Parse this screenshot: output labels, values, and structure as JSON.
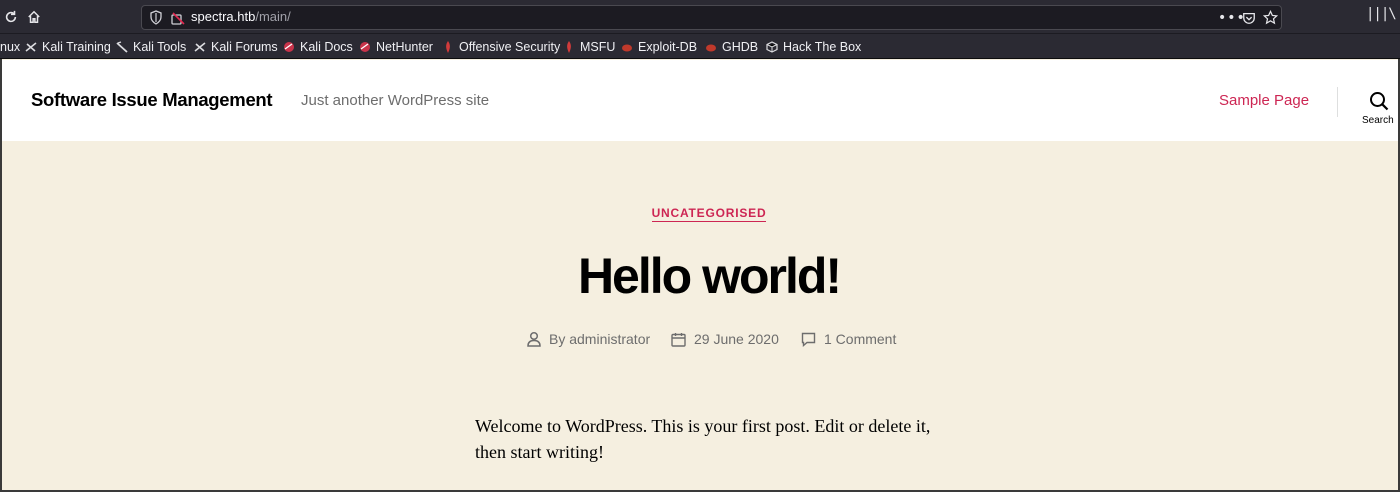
{
  "browser": {
    "url_host": "spectra.htb",
    "url_path": "/main/",
    "icons": [
      "reload-icon",
      "home-icon",
      "shield-icon",
      "page-actions-icon",
      "pocket-icon",
      "bookmark-star-icon",
      "library-icon"
    ],
    "bookmarks": [
      {
        "label": "nux",
        "icon": "none"
      },
      {
        "label": "Kali Training",
        "icon": "kali-icon"
      },
      {
        "label": "Kali Tools",
        "icon": "kali-icon"
      },
      {
        "label": "Kali Forums",
        "icon": "kali-icon"
      },
      {
        "label": "Kali Docs",
        "icon": "kali-docs-icon"
      },
      {
        "label": "NetHunter",
        "icon": "nethunter-icon"
      },
      {
        "label": "Offensive Security",
        "icon": "offsec-icon"
      },
      {
        "label": "MSFU",
        "icon": "offsec-icon"
      },
      {
        "label": "Exploit-DB",
        "icon": "exploitdb-icon"
      },
      {
        "label": "GHDB",
        "icon": "exploitdb-icon"
      },
      {
        "label": "Hack The Box",
        "icon": "htb-icon"
      }
    ]
  },
  "site": {
    "title": "Software Issue Management",
    "description": "Just another WordPress site",
    "nav": [
      "Sample Page"
    ],
    "search_label": "Search"
  },
  "post": {
    "category": "UNCATEGORISED",
    "title": "Hello world!",
    "author": "By administrator",
    "date": "29 June 2020",
    "comments": "1 Comment",
    "body": "Welcome to WordPress. This is your first post. Edit or delete it, then start writing!"
  },
  "colors": {
    "accent": "#cd2653",
    "background": "#f5efe0",
    "header_bg": "#ffffff",
    "browser_chrome": "#2b2a33"
  }
}
